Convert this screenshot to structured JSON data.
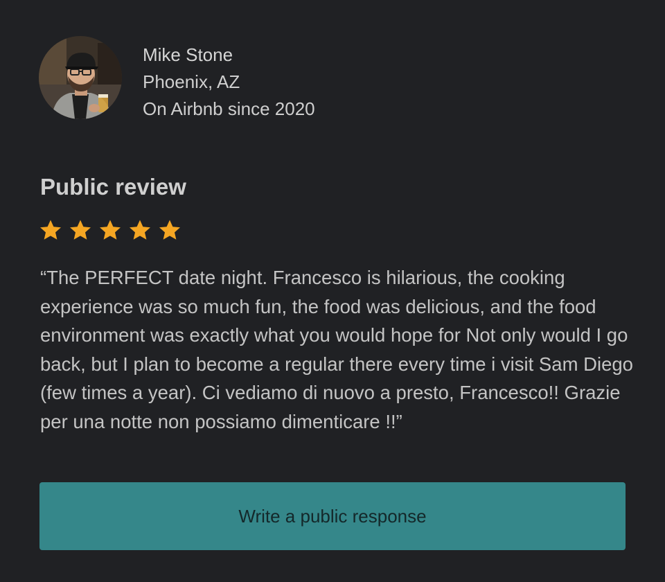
{
  "reviewer": {
    "name": "Mike Stone",
    "location": "Phoenix, AZ",
    "member_since": "On Airbnb since 2020"
  },
  "review": {
    "section_title": "Public review",
    "rating": 5,
    "rating_max": 5,
    "star_color": "#f5a623",
    "text": "“The PERFECT date night. Francesco is hilarious, the cooking experience was so much fun, the food was delicious, and the food environment was exactly what you would hope for Not only would I go back, but I plan to become a regular there every time i visit Sam Diego (few times a year). Ci vediamo di nuovo a presto, Francesco!! Grazie per una notte non possiamo dimenticare !!”"
  },
  "actions": {
    "response_button_label": "Write a public response",
    "response_button_color": "#35878a"
  }
}
